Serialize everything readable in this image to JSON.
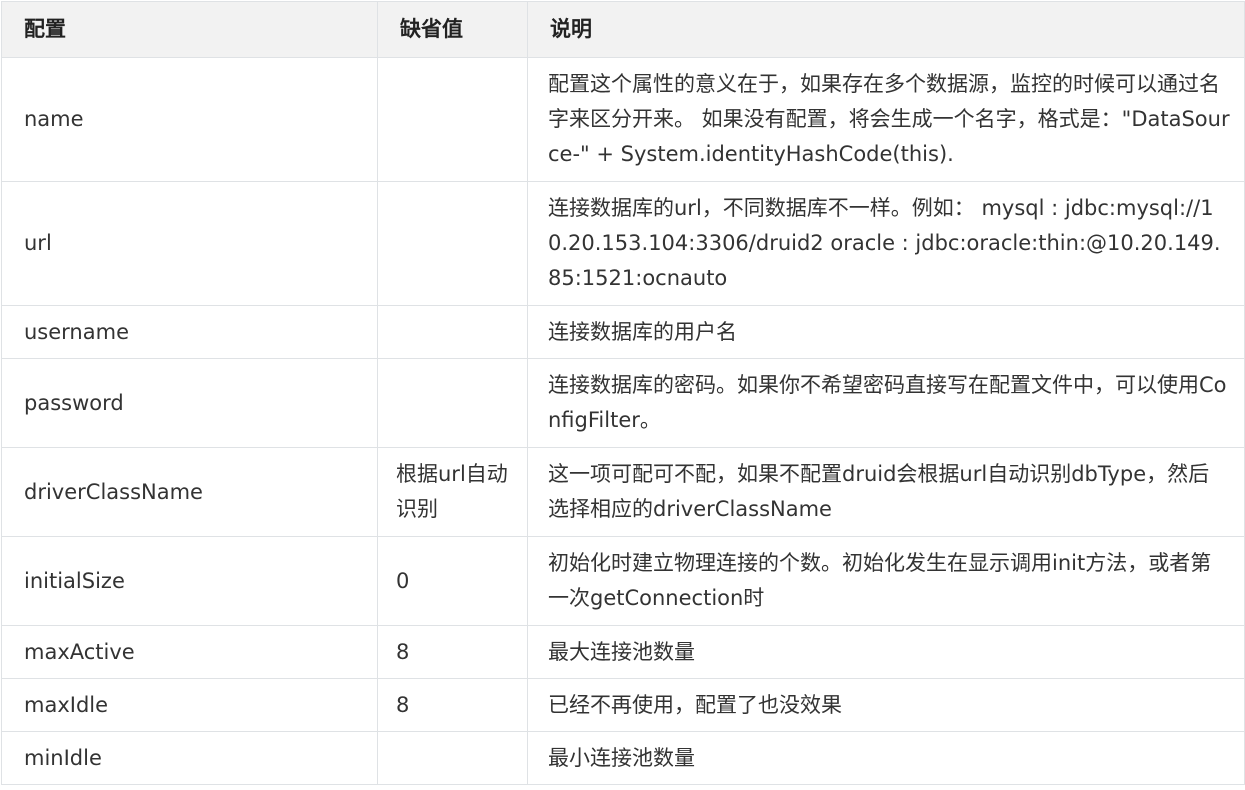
{
  "table": {
    "headers": {
      "config": "配置",
      "default": "缺省值",
      "description": "说明"
    },
    "rows": [
      {
        "config": "name",
        "default": "",
        "description": "配置这个属性的意义在于，如果存在多个数据源，监控的时候可以通过名字来区分开来。 如果没有配置，将会生成一个名字，格式是：\"DataSource-\" + System.identityHashCode(this)."
      },
      {
        "config": "url",
        "default": "",
        "description": "连接数据库的url，不同数据库不一样。例如： mysql : jdbc:mysql://10.20.153.104:3306/druid2 oracle : jdbc:oracle:thin:@10.20.149.85:1521:ocnauto"
      },
      {
        "config": "username",
        "default": "",
        "description": "连接数据库的用户名"
      },
      {
        "config": "password",
        "default": "",
        "description": "连接数据库的密码。如果你不希望密码直接写在配置文件中，可以使用ConfigFilter。"
      },
      {
        "config": "driverClassName",
        "default": "根据url自动识别",
        "description": "这一项可配可不配，如果不配置druid会根据url自动识别dbType，然后选择相应的driverClassName"
      },
      {
        "config": "initialSize",
        "default": "0",
        "description": "初始化时建立物理连接的个数。初始化发生在显示调用init方法，或者第一次getConnection时"
      },
      {
        "config": "maxActive",
        "default": "8",
        "description": "最大连接池数量"
      },
      {
        "config": "maxIdle",
        "default": "8",
        "description": "已经不再使用，配置了也没效果"
      },
      {
        "config": "minIdle",
        "default": "",
        "description": "最小连接池数量"
      }
    ]
  }
}
